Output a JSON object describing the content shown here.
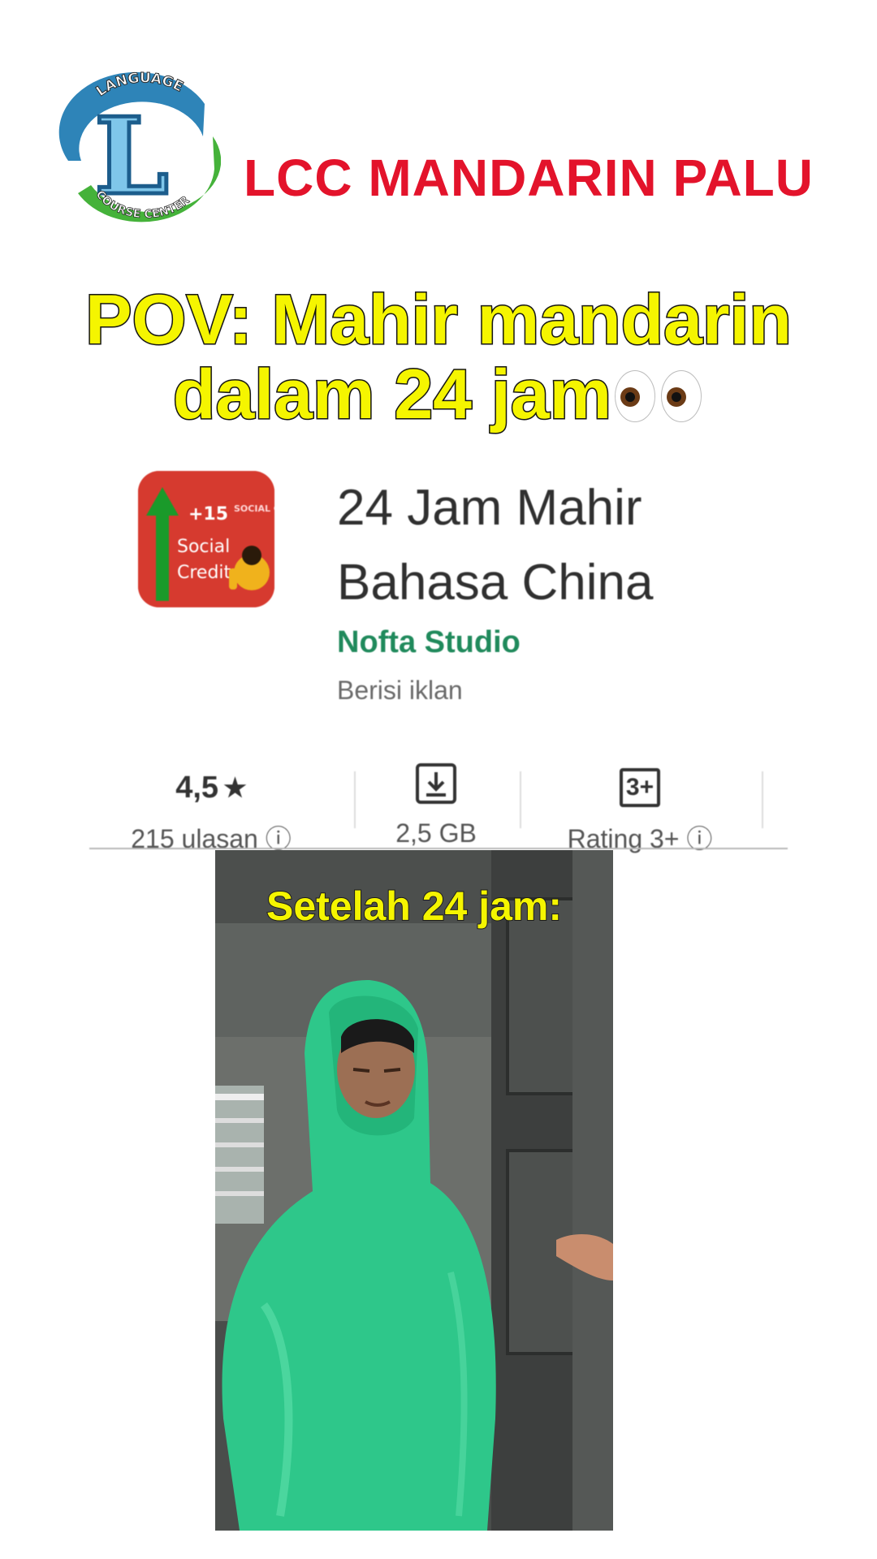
{
  "header": {
    "logo_top_text": "LANGUAGE",
    "logo_letter": "L",
    "logo_bottom_text": "COURSE CENTER",
    "brand_name": "LCC MANDARIN PALU",
    "brand_color": "#e3132b"
  },
  "caption": {
    "line1": "POV: Mahir mandarin",
    "line2": "dalam 24 jam",
    "emoji": "eyes-icon",
    "color": "#f5f500"
  },
  "app": {
    "title_line1": "24 Jam Mahir",
    "title_line2": "Bahasa China",
    "developer": "Nofta Studio",
    "contains_ads": "Berisi iklan",
    "icon": {
      "badge": "+15",
      "text1": "Social",
      "text2": "Credit",
      "corner": "SOCIAL CREDIT"
    },
    "stats": [
      {
        "value": "4,5",
        "icon": "star-icon",
        "label": "215 ulasan"
      },
      {
        "icon": "download-icon",
        "label": "2,5 GB"
      },
      {
        "icon": "content-rating-icon",
        "badge": "3+",
        "label": "Rating 3+"
      }
    ]
  },
  "video": {
    "caption": "Setelah 24 jam:"
  }
}
